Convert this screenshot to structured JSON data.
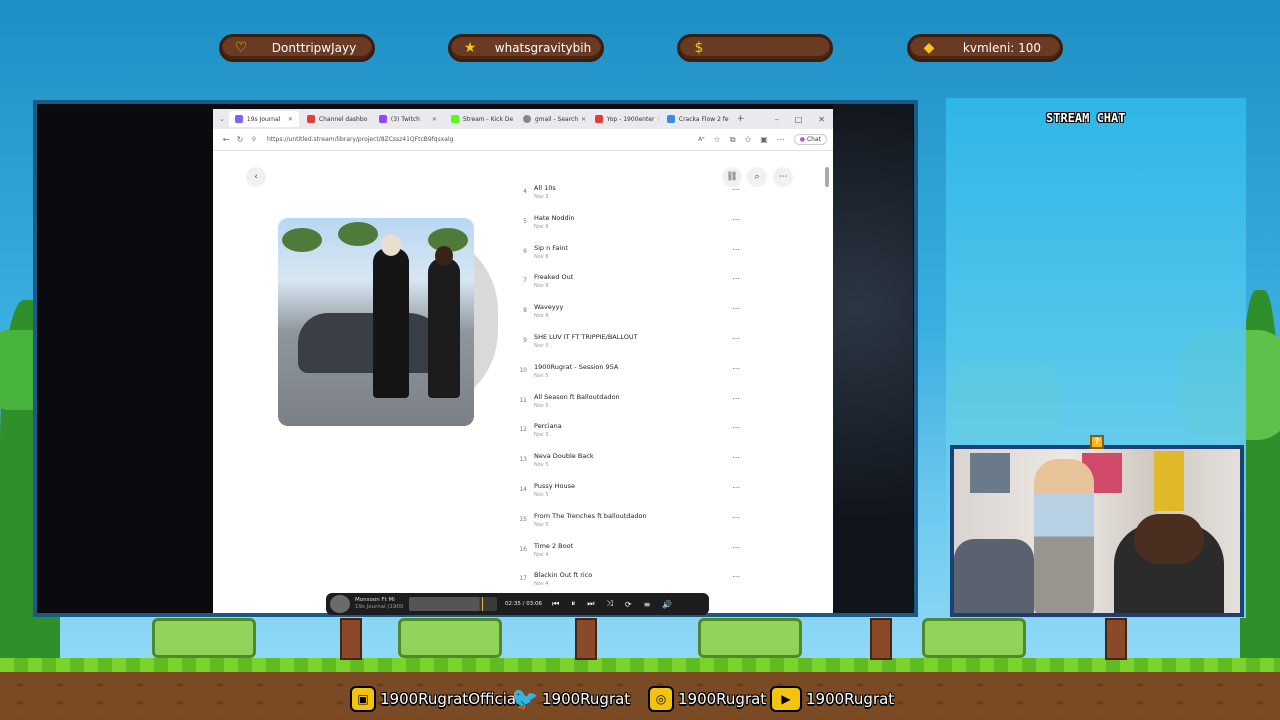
{
  "overlay": {
    "badges": [
      {
        "icon": "heart-icon",
        "label": "DonttripwJayy"
      },
      {
        "icon": "star-icon",
        "label": "whatsgravitybih"
      },
      {
        "icon": "money-bag-icon",
        "label": ""
      },
      {
        "icon": "diamond-icon",
        "label": "kvmleni: 100"
      }
    ],
    "chat_title": "STREAM CHAT",
    "socials": [
      {
        "icon": "twitch-icon",
        "handle": "1900RugratOfficial"
      },
      {
        "icon": "twitter-icon",
        "handle": "1900Rugrat"
      },
      {
        "icon": "instagram-icon",
        "handle": "1900Rugrat"
      },
      {
        "icon": "youtube-icon",
        "handle": "1900Rugrat"
      }
    ],
    "question_block": "?"
  },
  "browser": {
    "tabs": [
      {
        "label": "19s Journal",
        "active": true,
        "color": "#7b61ff"
      },
      {
        "label": "Channel dashbo",
        "active": false,
        "color": "#e03c3c"
      },
      {
        "label": "(3) Twitch",
        "active": false,
        "color": "#9146ff"
      },
      {
        "label": "Stream - Kick De",
        "active": false,
        "color": "#53fc18"
      },
      {
        "label": "gmail - Search",
        "active": false,
        "color": "#888888"
      },
      {
        "label": "Yop - 1900enter",
        "active": false,
        "color": "#e03c3c"
      },
      {
        "label": "Cracka Flow 2 fe",
        "active": false,
        "color": "#3c8be0"
      }
    ],
    "new_tab": "+",
    "window_controls": [
      "–",
      "□",
      "✕"
    ],
    "url": "https://untitled.stream/library/project/8ZCssz41QFtcB9fqsxalg",
    "chat_label": "Chat"
  },
  "tracks": [
    {
      "num": "4",
      "title": "All 10s",
      "date": "Nov 3"
    },
    {
      "num": "5",
      "title": "Hate Noddin",
      "date": "Nov 6"
    },
    {
      "num": "6",
      "title": "Sip n Faint",
      "date": "Nov 6"
    },
    {
      "num": "7",
      "title": "Freaked Out",
      "date": "Nov 6"
    },
    {
      "num": "8",
      "title": "Waveyyy",
      "date": "Nov 6"
    },
    {
      "num": "9",
      "title": "SHE LUV IT FT TRIPPIE/BALLOUT",
      "date": "Nov 5"
    },
    {
      "num": "10",
      "title": "1900Rugrat - Session 95A",
      "date": "Nov 5"
    },
    {
      "num": "11",
      "title": "All Season ft Balloutdadon",
      "date": "Nov 5"
    },
    {
      "num": "12",
      "title": "Perciana",
      "date": "Nov 5"
    },
    {
      "num": "13",
      "title": "Neva Double Back",
      "date": "Nov 5"
    },
    {
      "num": "14",
      "title": "Pussy House",
      "date": "Nov 5"
    },
    {
      "num": "15",
      "title": "From The Trenches ft balloutdadon",
      "date": "Nov 5"
    },
    {
      "num": "16",
      "title": "Time 2 Boot",
      "date": "Nov 4"
    },
    {
      "num": "17",
      "title": "Blackin Out ft rico",
      "date": "Nov 4"
    }
  ],
  "player": {
    "track_title": "Monsoon Ft Mi",
    "track_sub": "19s Journal (1900",
    "time": "02:35 / 03:06",
    "progress": 0.83
  }
}
